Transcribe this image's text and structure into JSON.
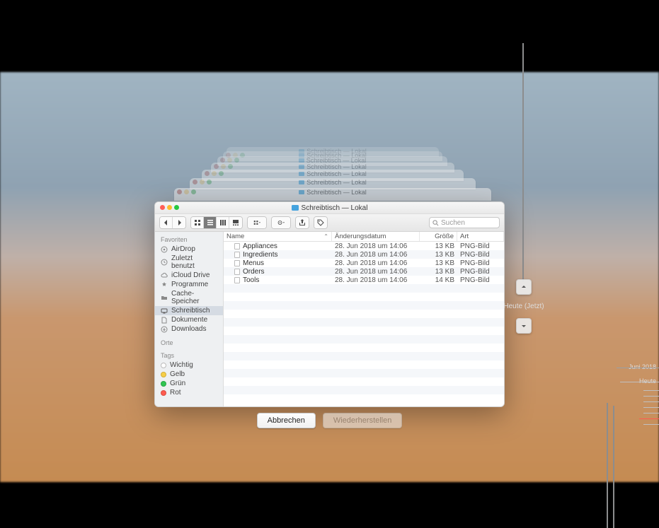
{
  "window": {
    "title": "Schreibtisch — Lokal",
    "ghost_title": "Schreibtisch — Lokal"
  },
  "toolbar": {
    "search_placeholder": "Suchen"
  },
  "sidebar": {
    "section_favorites": "Favoriten",
    "section_locations": "Orte",
    "section_tags": "Tags",
    "items": [
      {
        "label": "AirDrop"
      },
      {
        "label": "Zuletzt benutzt"
      },
      {
        "label": "iCloud Drive"
      },
      {
        "label": "Programme"
      },
      {
        "label": "Cache-Speicher"
      },
      {
        "label": "Schreibtisch"
      },
      {
        "label": "Dokumente"
      },
      {
        "label": "Downloads"
      }
    ],
    "tags": [
      {
        "label": "Wichtig",
        "color": "#c7c7c7"
      },
      {
        "label": "Gelb",
        "color": "#f7ce46"
      },
      {
        "label": "Grün",
        "color": "#30c552"
      },
      {
        "label": "Rot",
        "color": "#ff5b4f"
      }
    ]
  },
  "columns": {
    "name": "Name",
    "date": "Änderungsdatum",
    "size": "Größe",
    "kind": "Art"
  },
  "files": [
    {
      "name": "Appliances",
      "date": "28. Jun 2018 um 14:06",
      "size": "13 KB",
      "kind": "PNG-Bild"
    },
    {
      "name": "Ingredients",
      "date": "28. Jun 2018 um 14:06",
      "size": "13 KB",
      "kind": "PNG-Bild"
    },
    {
      "name": "Menus",
      "date": "28. Jun 2018 um 14:06",
      "size": "13 KB",
      "kind": "PNG-Bild"
    },
    {
      "name": "Orders",
      "date": "28. Jun 2018 um 14:06",
      "size": "13 KB",
      "kind": "PNG-Bild"
    },
    {
      "name": "Tools",
      "date": "28. Jun 2018 um 14:06",
      "size": "14 KB",
      "kind": "PNG-Bild"
    }
  ],
  "buttons": {
    "cancel": "Abbrechen",
    "restore": "Wiederherstellen"
  },
  "nav": {
    "label": "Heute (Jetzt)"
  },
  "timeline": {
    "month": "Juni 2018",
    "today": "Heute"
  }
}
